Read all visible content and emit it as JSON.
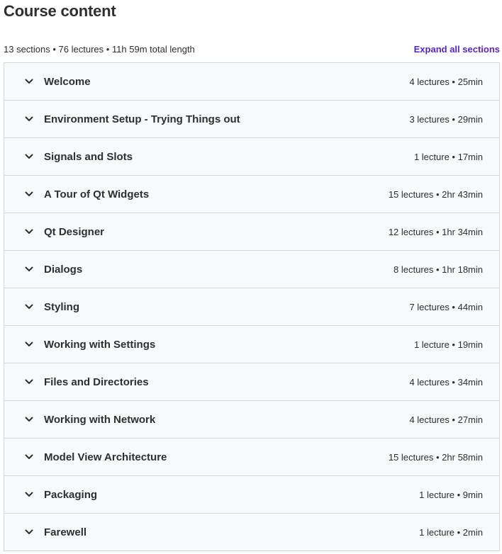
{
  "header": {
    "title": "Course content",
    "summary": "13 sections • 76 lectures • 11h 59m total length",
    "expand_all_label": "Expand all sections"
  },
  "colors": {
    "accent": "#5624d0",
    "section_bg": "#f7f9fa",
    "border": "#d1d7dc",
    "text": "#2d2f31"
  },
  "sections": [
    {
      "title": "Welcome",
      "meta": "4 lectures • 25min"
    },
    {
      "title": "Environment Setup - Trying Things out",
      "meta": "3 lectures • 29min"
    },
    {
      "title": "Signals and Slots",
      "meta": "1 lecture • 17min"
    },
    {
      "title": "A Tour of Qt Widgets",
      "meta": "15 lectures • 2hr 43min"
    },
    {
      "title": "Qt Designer",
      "meta": "12 lectures • 1hr 34min"
    },
    {
      "title": "Dialogs",
      "meta": "8 lectures • 1hr 18min"
    },
    {
      "title": "Styling",
      "meta": "7 lectures • 44min"
    },
    {
      "title": "Working with Settings",
      "meta": "1 lecture • 19min"
    },
    {
      "title": "Files and Directories",
      "meta": "4 lectures • 34min"
    },
    {
      "title": "Working with Network",
      "meta": "4 lectures • 27min"
    },
    {
      "title": "Model View Architecture",
      "meta": "15 lectures • 2hr 58min"
    },
    {
      "title": "Packaging",
      "meta": "1 lecture • 9min"
    },
    {
      "title": "Farewell",
      "meta": "1 lecture • 2min"
    }
  ]
}
